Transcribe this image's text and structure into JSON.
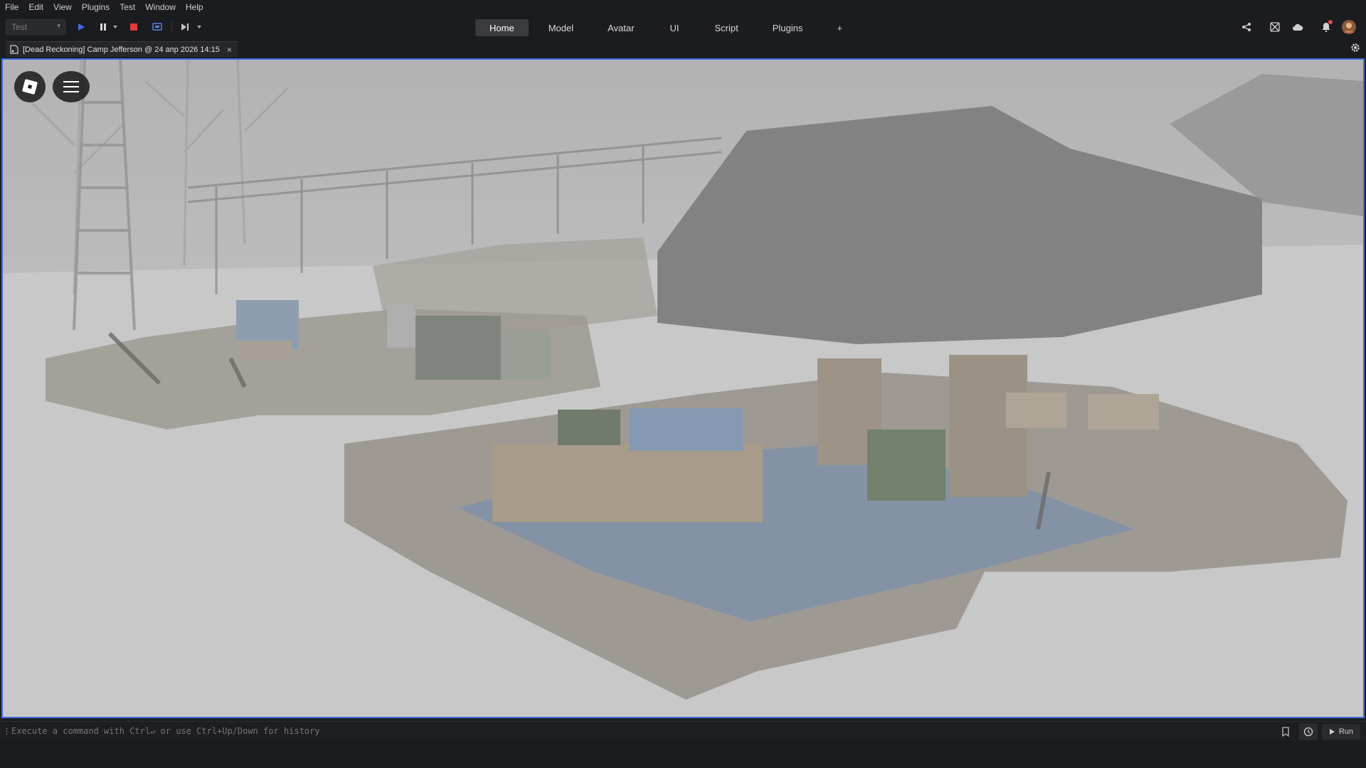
{
  "menu": [
    "File",
    "Edit",
    "View",
    "Plugins",
    "Test",
    "Window",
    "Help"
  ],
  "toolbar": {
    "mode_value": "Test",
    "icons": [
      "play-icon",
      "pause-icon",
      "stop-icon",
      "client-server-icon",
      "step-icon"
    ]
  },
  "tabs": [
    "Home",
    "Model",
    "Avatar",
    "UI",
    "Script",
    "Plugins",
    "+"
  ],
  "active_tab": "Home",
  "right_icons": [
    "share-icon",
    "collaborate-icon",
    "cloud-icon",
    "notifications-icon",
    "avatar"
  ],
  "document_tab": {
    "title": "[Dead Reckoning] Camp Jefferson @ 24 апр 2026 14:15",
    "close": "×"
  },
  "viewport": {
    "scene": "snowy military camp with sandbag walls and supply crates",
    "buttons": [
      "roblox-logo-icon",
      "hamburger-menu-icon"
    ]
  },
  "command_bar": {
    "placeholder": "Execute a command with Ctrl↵ or use Ctrl+Up/Down for history",
    "run_label": "Run"
  },
  "colors": {
    "accent": "#3a6ee0",
    "stop": "#e03b3b",
    "play": "#3d6de0",
    "notification": "#e54848"
  }
}
